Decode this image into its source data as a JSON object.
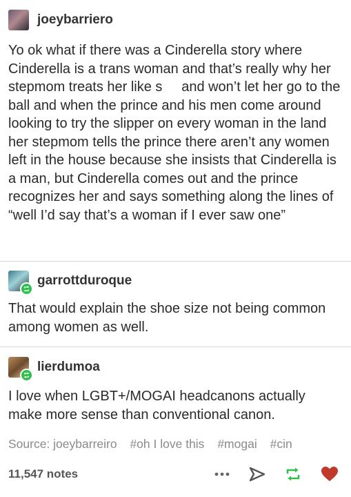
{
  "posts": [
    {
      "username": "joeybarriero",
      "body": "Yo ok what if there was a Cinderella story where Cinderella is a trans woman and that’s really why her stepmom treats her like s     and won’t let her go to the ball and when the prince and his men come around looking to try the slipper on every woman in the land her stepmom tells the prince there aren’t any women left in the house because she insists that Cinderella is a man, but Cinderella comes out and the prince recognizes her and says something along the lines of “well I’d say that’s a woman if I ever saw one”"
    },
    {
      "username": "garrottduroque",
      "body": "That would explain the shoe size not being common among women as well."
    },
    {
      "username": "lierdumoa",
      "body": "I love when LGBT+/MOGAI headcanons actually make more sense than conventional canon."
    }
  ],
  "source": {
    "label": "Source: joeybarreiro",
    "tags": [
      "#oh I love this",
      "#mogai",
      "#cin"
    ]
  },
  "footer": {
    "notes": "11,547 notes",
    "icons": [
      "more-icon",
      "share-icon",
      "reblog-icon",
      "like-icon"
    ]
  },
  "colors": {
    "reblog_green": "#2fbf4b",
    "like_red": "#c0392b",
    "tag_gray": "#8a8a8a"
  }
}
